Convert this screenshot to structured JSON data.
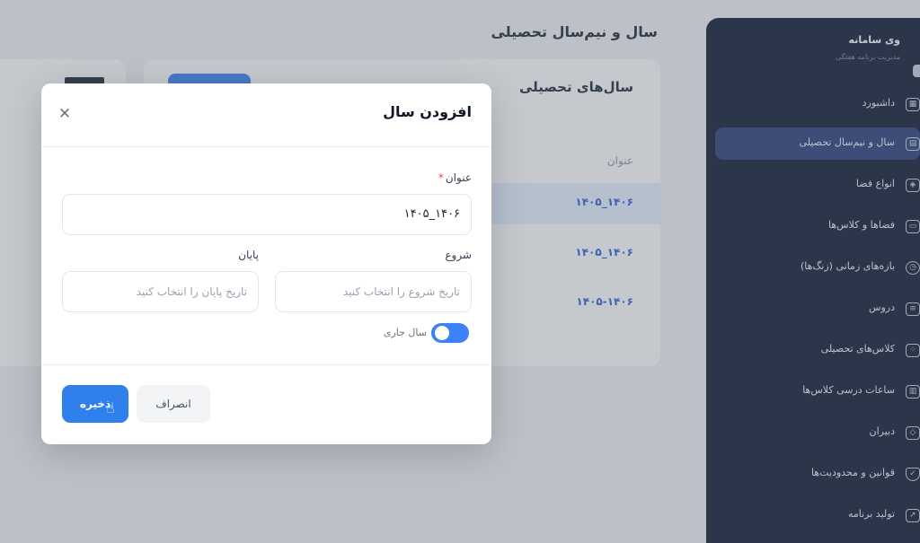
{
  "app": {
    "page_title": "سال و نیم‌سال تحصیلی",
    "card_title": "سال‌های تحصیلی",
    "column_header": "عنوان",
    "rows": [
      "۱۴۰۶_۱۴۰۵",
      "۱۴۰۶_۱۴۰۵",
      "۱۴۰۵-۱۴۰۶"
    ]
  },
  "sidebar": {
    "brand_title": "وی سامانه",
    "brand_subtitle": "مدیریت برنامه هفتگی",
    "items": [
      {
        "label": "داشبورد",
        "icon": "grid-icon",
        "active": false
      },
      {
        "label": "سال و نیم‌سال تحصیلی",
        "icon": "calendar-icon",
        "active": true
      },
      {
        "label": "انواع فضا",
        "icon": "layers-icon",
        "active": false
      },
      {
        "label": "فضاها و کلاس‌ها",
        "icon": "room-icon",
        "active": false
      },
      {
        "label": "بازه‌های زمانی (زنگ‌ها)",
        "icon": "clock-icon",
        "active": false
      },
      {
        "label": "دروس",
        "icon": "book-icon",
        "active": false
      },
      {
        "label": "کلاس‌های تحصیلی",
        "icon": "users-icon",
        "active": false
      },
      {
        "label": "ساعات درسی کلاس‌ها",
        "icon": "schedule-icon",
        "active": false
      },
      {
        "label": "دبیران",
        "icon": "teacher-icon",
        "active": false
      },
      {
        "label": "قوانین و محدودیت‌ها",
        "icon": "shield-icon",
        "active": false
      },
      {
        "label": "تولید برنامه",
        "icon": "rocket-icon",
        "active": false
      }
    ]
  },
  "modal": {
    "title": "افزودن سال",
    "title_label": "عنوان",
    "title_required": "*",
    "title_value": "۱۴۰۶_۱۴۰۵",
    "start_label": "شروع",
    "start_placeholder": "تاریخ شروع را انتخاب کنید",
    "end_label": "پایان",
    "end_placeholder": "تاریخ پایان را انتخاب کنید",
    "current_year_label": "سال جاری",
    "current_year_on": true,
    "save_label": "ذخیره",
    "cancel_label": "انصراف"
  },
  "colors": {
    "primary": "#2f80ed",
    "sidebar_bg": "#111a33",
    "sidebar_active": "#2b3e79"
  }
}
